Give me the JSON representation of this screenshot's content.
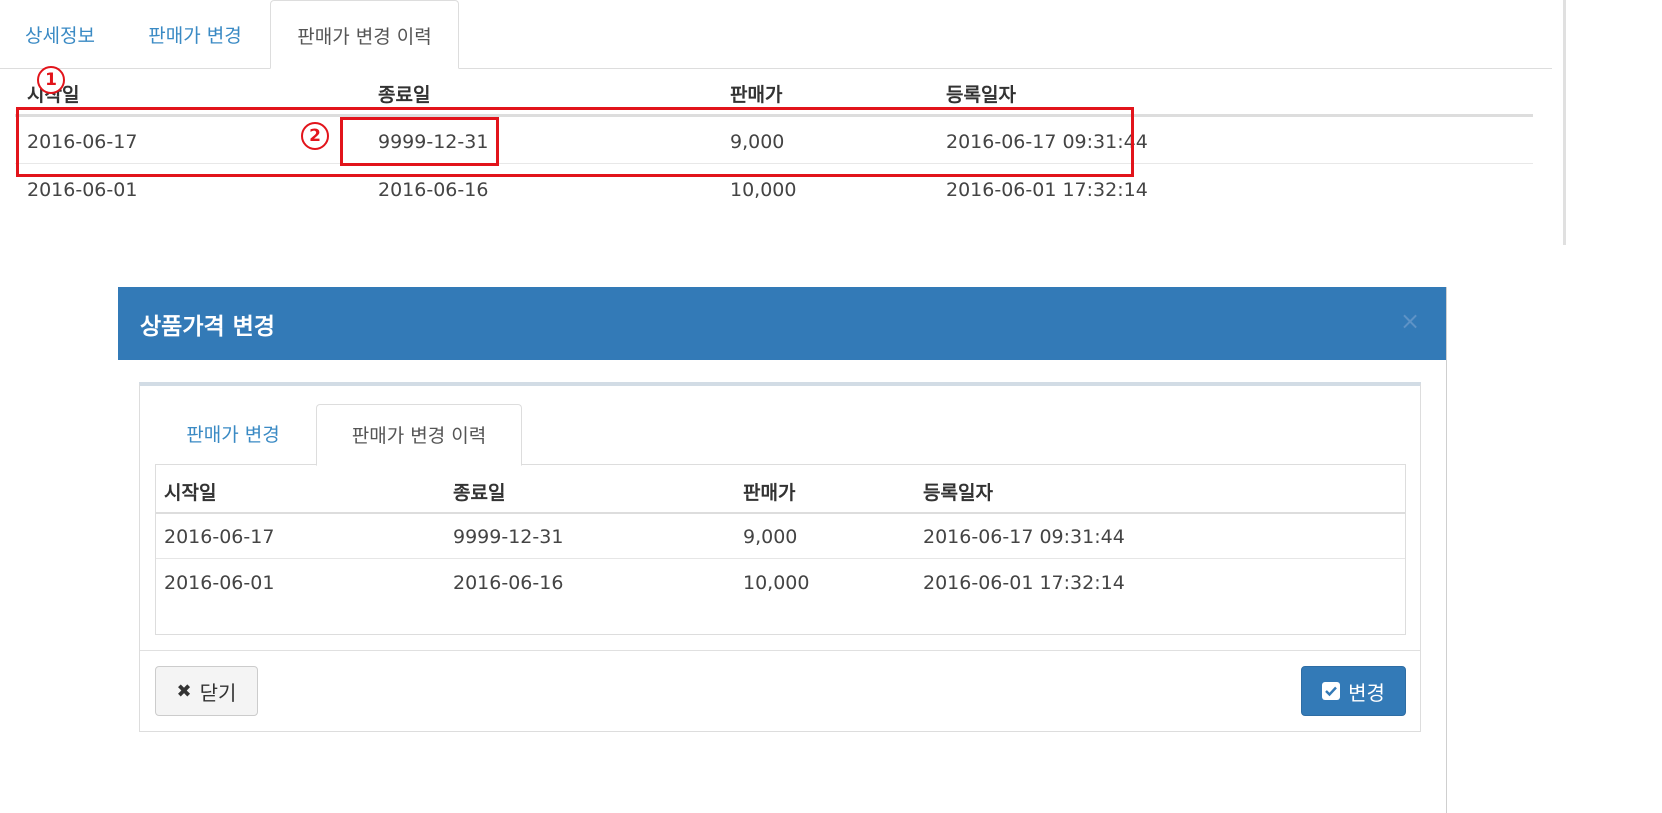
{
  "top_tabs": [
    {
      "label": "상세정보"
    },
    {
      "label": "판매가 변경"
    },
    {
      "label": "판매가 변경 이력"
    }
  ],
  "history_table": {
    "headers": [
      "시작일",
      "종료일",
      "판매가",
      "등록일자"
    ],
    "rows": [
      [
        "2016-06-17",
        "9999-12-31",
        "9,000",
        "2016-06-17 09:31:44"
      ],
      [
        "2016-06-01",
        "2016-06-16",
        "10,000",
        "2016-06-01 17:32:14"
      ]
    ]
  },
  "annotations": {
    "badge1": "1",
    "badge2": "2",
    "highlight_color": "#e2141b"
  },
  "modal": {
    "title": "상품가격 변경",
    "close_icon": "×",
    "tabs": [
      {
        "label": "판매가 변경"
      },
      {
        "label": "판매가 변경 이력"
      }
    ],
    "table": {
      "headers": [
        "시작일",
        "종료일",
        "판매가",
        "등록일자"
      ],
      "rows": [
        [
          "2016-06-17",
          "9999-12-31",
          "9,000",
          "2016-06-17 09:31:44"
        ],
        [
          "2016-06-01",
          "2016-06-16",
          "10,000",
          "2016-06-01 17:32:14"
        ]
      ]
    },
    "close_button": "닫기",
    "change_button": "변경",
    "accent_color": "#337ab7"
  }
}
